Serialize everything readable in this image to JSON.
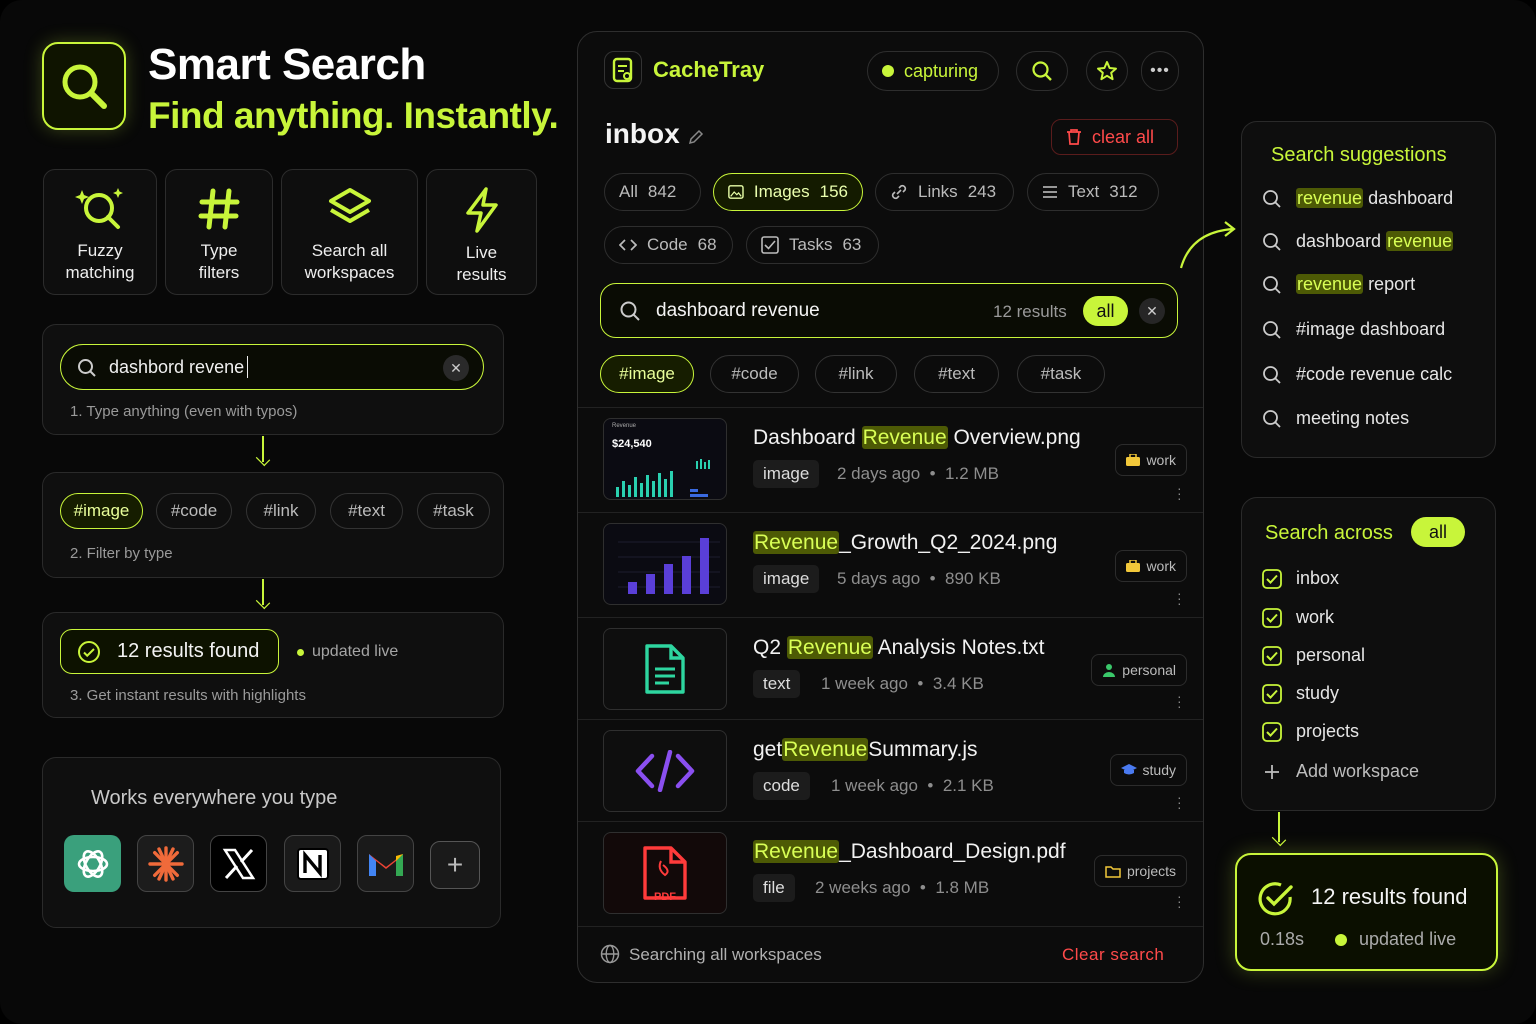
{
  "hero": {
    "title": "Smart Search",
    "subtitle": "Find anything. Instantly."
  },
  "features": [
    {
      "icon": "fuzzy-search-icon",
      "l1": "Fuzzy",
      "l2": "matching"
    },
    {
      "icon": "hash-icon",
      "l1": "Type",
      "l2": "filters"
    },
    {
      "icon": "layers-icon",
      "l1": "Search all",
      "l2": "workspaces"
    },
    {
      "icon": "lightning-icon",
      "l1": "Live",
      "l2": "results"
    }
  ],
  "steps": {
    "typo_query": "dashbord revene",
    "step1": "1. Type anything (even with typos)",
    "filters": [
      "#image",
      "#code",
      "#link",
      "#text",
      "#task"
    ],
    "step2": "2. Filter by type",
    "results_found": "12 results found",
    "updated_live": "updated live",
    "step3": "3. Get instant results with highlights"
  },
  "works": {
    "title": "Works everywhere you type",
    "apps": [
      "chatgpt-icon",
      "claude-icon",
      "x-icon",
      "notion-icon",
      "gmail-icon",
      "add-app-icon"
    ]
  },
  "app": {
    "name": "CacheTray",
    "status": "capturing",
    "folder": "inbox",
    "clear_all": "clear all",
    "tabs": [
      {
        "label": "All",
        "count": "842"
      },
      {
        "label": "Images",
        "count": "156"
      },
      {
        "label": "Links",
        "count": "243"
      },
      {
        "label": "Text",
        "count": "312"
      },
      {
        "label": "Code",
        "count": "68"
      },
      {
        "label": "Tasks",
        "count": "63"
      }
    ],
    "search": {
      "query": "dashboard revenue",
      "count": "12 results",
      "scope": "all"
    },
    "filters": [
      "#image",
      "#code",
      "#link",
      "#text",
      "#task"
    ],
    "results": [
      {
        "pre": "Dashboard ",
        "hl": "Revenue",
        "post": " Overview.png",
        "type": "image",
        "time": "2 days ago",
        "size": "1.2 MB",
        "ws": "work"
      },
      {
        "pre": "",
        "hl": "Revenue",
        "post": "_Growth_Q2_2024.png",
        "type": "image",
        "time": "5 days ago",
        "size": "890 KB",
        "ws": "work"
      },
      {
        "pre": "Q2 ",
        "hl": "Revenue",
        "post": " Analysis Notes.txt",
        "type": "text",
        "time": "1 week ago",
        "size": "3.4 KB",
        "ws": "personal"
      },
      {
        "pre": "get",
        "hl": "Revenue",
        "post": "Summary.js",
        "type": "code",
        "time": "1 week ago",
        "size": "2.1 KB",
        "ws": "study"
      },
      {
        "pre": "",
        "hl": "Revenue",
        "post": "_Dashboard_Design.pdf",
        "type": "file",
        "time": "2 weeks ago",
        "size": "1.8 MB",
        "ws": "projects"
      }
    ],
    "thumb1": {
      "title": "Revenue",
      "amount": "$24,540"
    },
    "pdf_label": "PDF",
    "footer": {
      "scope": "Searching all workspaces",
      "clear": "Clear search"
    }
  },
  "suggestions": {
    "title": "Search suggestions",
    "items": [
      {
        "pre": "",
        "hl": "revenue",
        "post": " dashboard"
      },
      {
        "pre": "dashboard ",
        "hl": "revenue",
        "post": ""
      },
      {
        "pre": "",
        "hl": "revenue",
        "post": " report"
      },
      {
        "pre": "#image dashboard",
        "hl": "",
        "post": ""
      },
      {
        "pre": "#code revenue calc",
        "hl": "",
        "post": ""
      },
      {
        "pre": "meeting notes",
        "hl": "",
        "post": ""
      }
    ]
  },
  "across": {
    "title": "Search across",
    "badge": "all",
    "items": [
      "inbox",
      "work",
      "personal",
      "study",
      "projects"
    ],
    "add": "Add workspace"
  },
  "summary": {
    "found": "12 results found",
    "time": "0.18s",
    "live": "updated live"
  },
  "colors": {
    "accent": "#c8f53a",
    "danger": "#ff4a4a",
    "background": "#080808"
  }
}
